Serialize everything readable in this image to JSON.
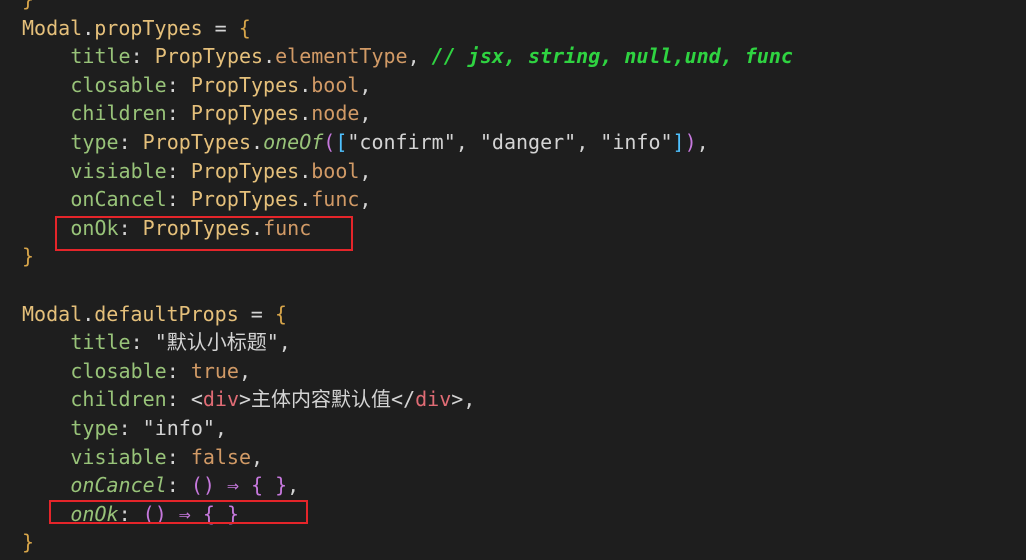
{
  "colors": {
    "background": "#1e1e1e",
    "highlight_box": "#e5252a"
  },
  "code_lines": [
    {
      "indent": 0,
      "tokens": [
        {
          "t": "}",
          "c": "#d7a54a"
        }
      ]
    },
    {
      "indent": 0,
      "tokens": [
        {
          "t": "Modal",
          "c": "#e5c07b"
        },
        {
          "t": ".",
          "c": "#d4d4d4"
        },
        {
          "t": "propTypes",
          "c": "#e5c07b"
        },
        {
          "t": " = ",
          "c": "#d4d4d4"
        },
        {
          "t": "{",
          "c": "#d7a54a"
        }
      ]
    },
    {
      "indent": 4,
      "tokens": [
        {
          "t": "title",
          "c": "#98c379"
        },
        {
          "t": ": ",
          "c": "#d4d4d4"
        },
        {
          "t": "PropTypes",
          "c": "#e5c07b"
        },
        {
          "t": ".",
          "c": "#d4d4d4"
        },
        {
          "t": "elementType",
          "c": "#d19a66"
        },
        {
          "t": ", ",
          "c": "#d4d4d4"
        },
        {
          "t": "// jsx, string, null,und, func",
          "c": "#2fd341",
          "b": true,
          "i": true
        }
      ]
    },
    {
      "indent": 4,
      "tokens": [
        {
          "t": "closable",
          "c": "#98c379"
        },
        {
          "t": ": ",
          "c": "#d4d4d4"
        },
        {
          "t": "PropTypes",
          "c": "#e5c07b"
        },
        {
          "t": ".",
          "c": "#d4d4d4"
        },
        {
          "t": "bool",
          "c": "#d19a66"
        },
        {
          "t": ",",
          "c": "#d4d4d4"
        }
      ]
    },
    {
      "indent": 4,
      "tokens": [
        {
          "t": "children",
          "c": "#98c379"
        },
        {
          "t": ": ",
          "c": "#d4d4d4"
        },
        {
          "t": "PropTypes",
          "c": "#e5c07b"
        },
        {
          "t": ".",
          "c": "#d4d4d4"
        },
        {
          "t": "node",
          "c": "#d19a66"
        },
        {
          "t": ",",
          "c": "#d4d4d4"
        }
      ]
    },
    {
      "indent": 4,
      "tokens": [
        {
          "t": "type",
          "c": "#98c379"
        },
        {
          "t": ": ",
          "c": "#d4d4d4"
        },
        {
          "t": "PropTypes",
          "c": "#e5c07b"
        },
        {
          "t": ".",
          "c": "#d4d4d4"
        },
        {
          "t": "oneOf",
          "c": "#98c379",
          "i": true
        },
        {
          "t": "(",
          "c": "#c678dd"
        },
        {
          "t": "[",
          "c": "#4fc1ff"
        },
        {
          "t": "\"confirm\"",
          "c": "#d4d4d4"
        },
        {
          "t": ", ",
          "c": "#d4d4d4"
        },
        {
          "t": "\"danger\"",
          "c": "#d4d4d4"
        },
        {
          "t": ", ",
          "c": "#d4d4d4"
        },
        {
          "t": "\"info\"",
          "c": "#d4d4d4"
        },
        {
          "t": "]",
          "c": "#4fc1ff"
        },
        {
          "t": ")",
          "c": "#c678dd"
        },
        {
          "t": ",",
          "c": "#d4d4d4"
        }
      ]
    },
    {
      "indent": 4,
      "tokens": [
        {
          "t": "visiable",
          "c": "#98c379"
        },
        {
          "t": ": ",
          "c": "#d4d4d4"
        },
        {
          "t": "PropTypes",
          "c": "#e5c07b"
        },
        {
          "t": ".",
          "c": "#d4d4d4"
        },
        {
          "t": "bool",
          "c": "#d19a66"
        },
        {
          "t": ",",
          "c": "#d4d4d4"
        }
      ]
    },
    {
      "indent": 4,
      "tokens": [
        {
          "t": "onCancel",
          "c": "#98c379"
        },
        {
          "t": ": ",
          "c": "#d4d4d4"
        },
        {
          "t": "PropTypes",
          "c": "#e5c07b"
        },
        {
          "t": ".",
          "c": "#d4d4d4"
        },
        {
          "t": "func",
          "c": "#d19a66"
        },
        {
          "t": ",",
          "c": "#d4d4d4"
        }
      ]
    },
    {
      "indent": 4,
      "tokens": [
        {
          "t": "onOk",
          "c": "#98c379"
        },
        {
          "t": ": ",
          "c": "#d4d4d4"
        },
        {
          "t": "PropTypes",
          "c": "#e5c07b"
        },
        {
          "t": ".",
          "c": "#d4d4d4"
        },
        {
          "t": "func",
          "c": "#d19a66"
        }
      ]
    },
    {
      "indent": 0,
      "tokens": [
        {
          "t": "}",
          "c": "#d7a54a"
        }
      ]
    },
    {
      "indent": 0,
      "tokens": []
    },
    {
      "indent": 0,
      "tokens": [
        {
          "t": "Modal",
          "c": "#e5c07b"
        },
        {
          "t": ".",
          "c": "#d4d4d4"
        },
        {
          "t": "defaultProps",
          "c": "#e5c07b"
        },
        {
          "t": " = ",
          "c": "#d4d4d4"
        },
        {
          "t": "{",
          "c": "#d7a54a"
        }
      ]
    },
    {
      "indent": 4,
      "tokens": [
        {
          "t": "title",
          "c": "#98c379"
        },
        {
          "t": ": ",
          "c": "#d4d4d4"
        },
        {
          "t": "\"默认小标题\"",
          "c": "#d4d4d4"
        },
        {
          "t": ",",
          "c": "#d4d4d4"
        }
      ]
    },
    {
      "indent": 4,
      "tokens": [
        {
          "t": "closable",
          "c": "#98c379"
        },
        {
          "t": ": ",
          "c": "#d4d4d4"
        },
        {
          "t": "true",
          "c": "#d19a66"
        },
        {
          "t": ",",
          "c": "#d4d4d4"
        }
      ]
    },
    {
      "indent": 4,
      "tokens": [
        {
          "t": "children",
          "c": "#98c379"
        },
        {
          "t": ": ",
          "c": "#d4d4d4"
        },
        {
          "t": "<",
          "c": "#d4d4d4"
        },
        {
          "t": "div",
          "c": "#e06c75"
        },
        {
          "t": ">",
          "c": "#d4d4d4"
        },
        {
          "t": "主体内容默认值",
          "c": "#d4d4d4"
        },
        {
          "t": "</",
          "c": "#d4d4d4"
        },
        {
          "t": "div",
          "c": "#e06c75"
        },
        {
          "t": ">",
          "c": "#d4d4d4"
        },
        {
          "t": ",",
          "c": "#d4d4d4"
        }
      ]
    },
    {
      "indent": 4,
      "tokens": [
        {
          "t": "type",
          "c": "#98c379"
        },
        {
          "t": ": ",
          "c": "#d4d4d4"
        },
        {
          "t": "\"info\"",
          "c": "#d4d4d4"
        },
        {
          "t": ",",
          "c": "#d4d4d4"
        }
      ]
    },
    {
      "indent": 4,
      "tokens": [
        {
          "t": "visiable",
          "c": "#98c379"
        },
        {
          "t": ": ",
          "c": "#d4d4d4"
        },
        {
          "t": "false",
          "c": "#d19a66"
        },
        {
          "t": ",",
          "c": "#d4d4d4"
        }
      ]
    },
    {
      "indent": 4,
      "tokens": [
        {
          "t": "onCancel",
          "c": "#98c379",
          "i": true
        },
        {
          "t": ": ",
          "c": "#d4d4d4"
        },
        {
          "t": "()",
          "c": "#c678dd"
        },
        {
          "t": " ⇒ ",
          "c": "#c678dd"
        },
        {
          "t": "{ }",
          "c": "#c678dd"
        },
        {
          "t": ",",
          "c": "#d4d4d4"
        }
      ]
    },
    {
      "indent": 4,
      "tokens": [
        {
          "t": "onOk",
          "c": "#98c379",
          "i": true
        },
        {
          "t": ": ",
          "c": "#d4d4d4"
        },
        {
          "t": "()",
          "c": "#c678dd"
        },
        {
          "t": " ⇒ ",
          "c": "#c678dd"
        },
        {
          "t": "{ }",
          "c": "#c678dd"
        }
      ]
    },
    {
      "indent": 0,
      "tokens": [
        {
          "t": "}",
          "c": "#d7a54a"
        }
      ]
    }
  ]
}
